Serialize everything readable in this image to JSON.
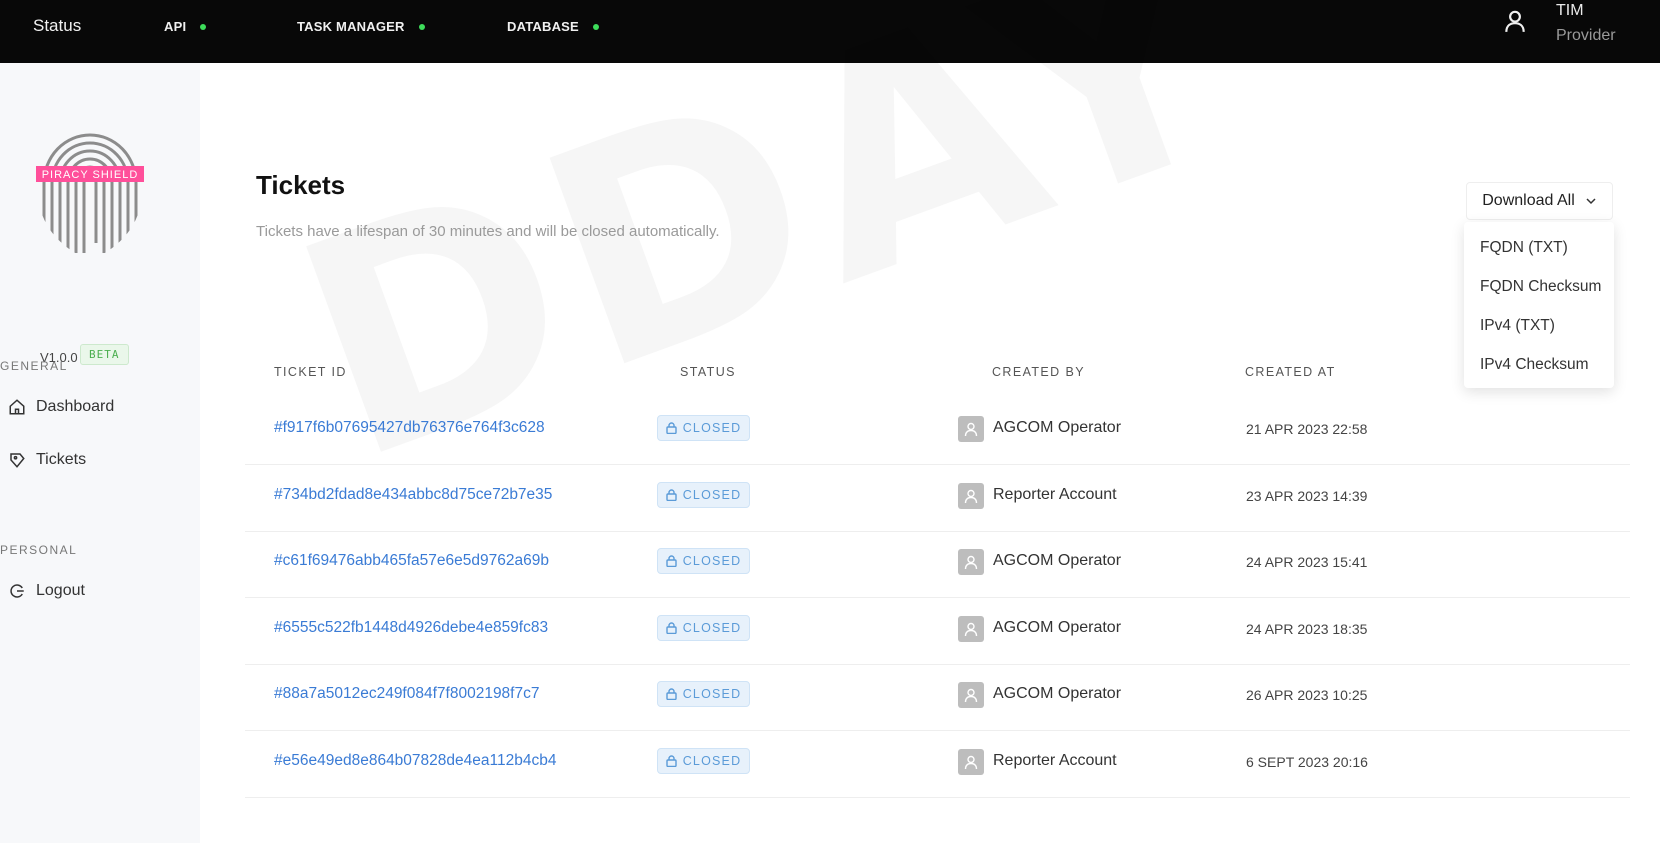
{
  "topbar": {
    "status_label": "Status",
    "services": [
      {
        "name": "API",
        "state_color": "#3ddc5a"
      },
      {
        "name": "TASK MANAGER",
        "state_color": "#3ddc5a"
      },
      {
        "name": "DATABASE",
        "state_color": "#3ddc5a"
      }
    ],
    "user": {
      "name": "TIM",
      "role": "Provider",
      "icon": "user-icon"
    }
  },
  "sidebar": {
    "logo_text": "PIRACY SHIELD",
    "version": "V1.0.0",
    "badge": "BETA",
    "sections": [
      {
        "label": "GENERAL",
        "items": [
          {
            "label": "Dashboard",
            "icon": "home-icon"
          },
          {
            "label": "Tickets",
            "icon": "ticket-icon"
          }
        ]
      },
      {
        "label": "PERSONAL",
        "items": [
          {
            "label": "Logout",
            "icon": "logout-icon"
          }
        ]
      }
    ]
  },
  "main": {
    "title": "Tickets",
    "subtitle": "Tickets have a lifespan of 30 minutes and will be closed automatically.",
    "download": {
      "label": "Download All",
      "options": [
        "FQDN (TXT)",
        "FQDN Checksum",
        "IPv4 (TXT)",
        "IPv4 Checksum"
      ]
    },
    "table": {
      "columns": [
        "TICKET ID",
        "STATUS",
        "CREATED BY",
        "CREATED AT"
      ],
      "rows": [
        {
          "id": "#f917f6b07695427db76376e764f3c628",
          "status": "CLOSED",
          "created_by": "AGCOM Operator",
          "created_at": "21 APR 2023 22:58"
        },
        {
          "id": "#734bd2fdad8e434abbc8d75ce72b7e35",
          "status": "CLOSED",
          "created_by": "Reporter Account",
          "created_at": "23 APR 2023 14:39"
        },
        {
          "id": "#c61f69476abb465fa57e6e5d9762a69b",
          "status": "CLOSED",
          "created_by": "AGCOM Operator",
          "created_at": "24 APR 2023 15:41"
        },
        {
          "id": "#6555c522fb1448d4926debe4e859fc83",
          "status": "CLOSED",
          "created_by": "AGCOM Operator",
          "created_at": "24 APR 2023 18:35"
        },
        {
          "id": "#88a7a5012ec249f084f7f8002198f7c7",
          "status": "CLOSED",
          "created_by": "AGCOM Operator",
          "created_at": "26 APR 2023 10:25"
        },
        {
          "id": "#e56e49ed8e864b07828de4ea112b4cb4",
          "status": "CLOSED",
          "created_by": "Reporter Account",
          "created_at": "6 SEPT 2023 20:16"
        }
      ]
    },
    "watermark": "DDAY"
  },
  "colors": {
    "topbar_bg": "#080808",
    "service_ok": "#3ddc5a",
    "link": "#3a7bd5",
    "status_closed_bg": "#e7f1fb",
    "logo_band": "#ff4f9a"
  }
}
